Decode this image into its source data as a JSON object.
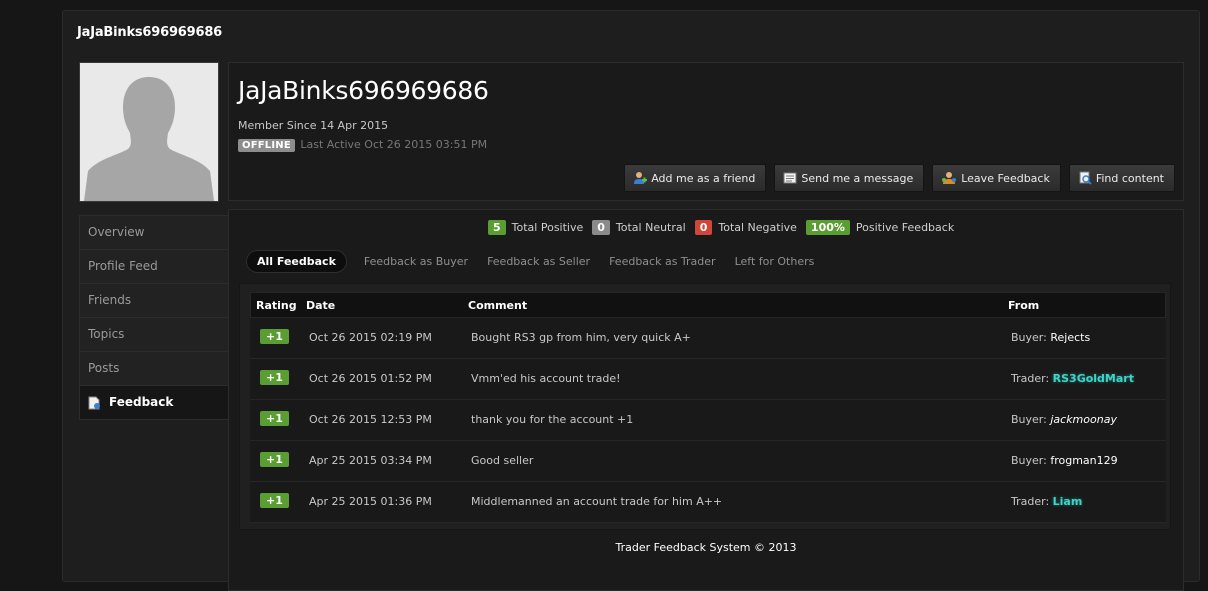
{
  "page": {
    "title": "JaJaBinks696969686"
  },
  "profile": {
    "username": "JaJaBinks696969686",
    "member_since": "Member Since 14 Apr 2015",
    "status_badge": "OFFLINE",
    "last_active": "Last Active Oct 26 2015 03:51 PM",
    "actions": [
      {
        "label": "Add me as a friend",
        "icon": "add-friend-icon"
      },
      {
        "label": "Send me a message",
        "icon": "message-icon"
      },
      {
        "label": "Leave Feedback",
        "icon": "feedback-icon"
      },
      {
        "label": "Find content",
        "icon": "search-content-icon"
      }
    ]
  },
  "sidebar": {
    "items": [
      {
        "label": "Overview"
      },
      {
        "label": "Profile Feed"
      },
      {
        "label": "Friends"
      },
      {
        "label": "Topics"
      },
      {
        "label": "Posts"
      },
      {
        "label": "Feedback",
        "active": true,
        "icon": "feedback-doc-icon"
      }
    ]
  },
  "feedback": {
    "stats": [
      {
        "value": "5",
        "label": "Total Positive",
        "color": "#5a9e33"
      },
      {
        "value": "0",
        "label": "Total Neutral",
        "color": "#8a8a8a"
      },
      {
        "value": "0",
        "label": "Total Negative",
        "color": "#d0473a"
      },
      {
        "value": "100%",
        "label": "Positive Feedback",
        "color": "#5a9e33"
      }
    ],
    "tabs": [
      {
        "label": "All Feedback",
        "active": true
      },
      {
        "label": "Feedback as Buyer"
      },
      {
        "label": "Feedback as Seller"
      },
      {
        "label": "Feedback as Trader"
      },
      {
        "label": "Left for Others"
      }
    ],
    "columns": {
      "rating": "Rating",
      "date": "Date",
      "comment": "Comment",
      "from": "From"
    },
    "rows": [
      {
        "rating": "+1",
        "date": "Oct 26 2015 02:19 PM",
        "comment": "Bought RS3 gp from him, very quick A+",
        "role": "Buyer:",
        "name": "Rejects",
        "style": "plain"
      },
      {
        "rating": "+1",
        "date": "Oct 26 2015 01:52 PM",
        "comment": "Vmm'ed his account trade!",
        "role": "Trader:",
        "name": "RS3GoldMart",
        "style": "highlight"
      },
      {
        "rating": "+1",
        "date": "Oct 26 2015 12:53 PM",
        "comment": "thank you for the account +1",
        "role": "Buyer:",
        "name": "jackmoonay",
        "style": "italic"
      },
      {
        "rating": "+1",
        "date": "Apr 25 2015 03:34 PM",
        "comment": "Good seller",
        "role": "Buyer:",
        "name": "frogman129",
        "style": "plain"
      },
      {
        "rating": "+1",
        "date": "Apr 25 2015 01:36 PM",
        "comment": "Middlemanned an account trade for him A++",
        "role": "Trader:",
        "name": "Liam",
        "style": "highlight"
      }
    ],
    "footer": "Trader Feedback System © 2013"
  }
}
